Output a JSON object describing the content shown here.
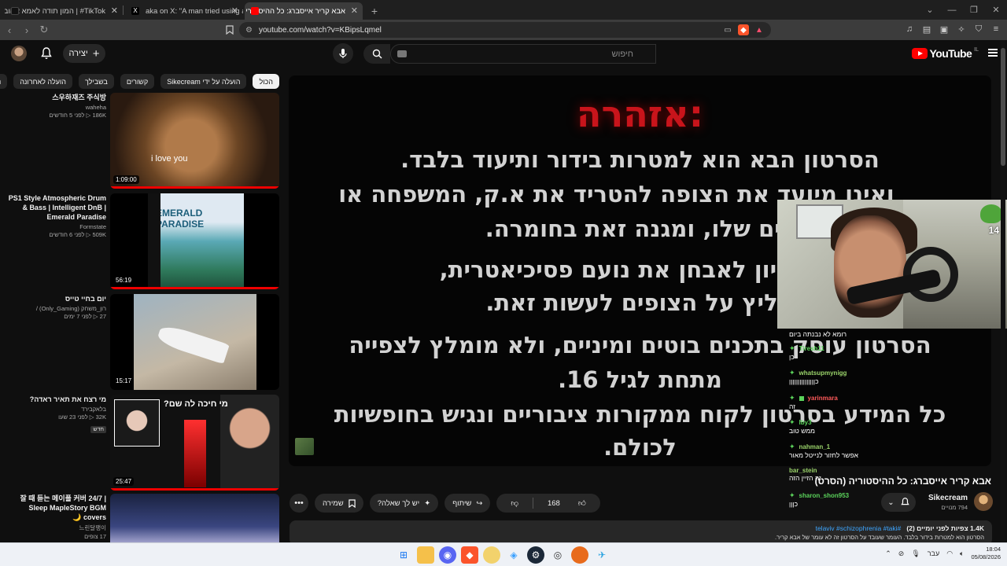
{
  "browser": {
    "tabs": [
      {
        "title": "TikTok# | המון תודה לאמא אהובה",
        "active": false,
        "fav_color": "#111111"
      },
      {
        "title": "aka on X: \"A man tried using an AI-g",
        "active": false,
        "fav_color": "#000000"
      },
      {
        "title": "אבא קריר אייסברג: כל ההיסטורי",
        "active": true,
        "fav_color": "#ff0000"
      }
    ],
    "new_tab": "+",
    "url": "youtube.com/watch?v=KBipsLqmel",
    "window_controls": [
      "⌄",
      "—",
      "❐",
      "✕"
    ]
  },
  "youtube": {
    "logo_text": "YouTube",
    "logo_country": "IL",
    "search_placeholder": "חיפוש",
    "create_label": "יצירה",
    "chips": [
      "הכול",
      "הועלה על ידי Sikecream",
      "קשורים",
      "בשבילך",
      "הועלה לאחרונה",
      "נצפו"
    ],
    "related": [
      {
        "title": "스우하재즈 주식방",
        "channel": "waheha",
        "stats": "186K ▷ לפני 5 חודשים",
        "duration": "1:09:00",
        "progress": 1.0,
        "thumb": "monkey",
        "caption": "i love you"
      },
      {
        "title": "PS1 Style Atmospheric Drum & Bass | Intelligent DnB | Emerald Paradise",
        "channel": "Formstate",
        "stats": "509K ▷ לפני 6 חודשים",
        "duration": "56:19",
        "progress": 1.0,
        "thumb": "ps1",
        "caption": "EMERALD PARADISE"
      },
      {
        "title": "יום בחיי טייס",
        "channel": "רון_משחק (Only_Gaming) /",
        "stats": "27 ▷ לפני 7 ימים",
        "duration": "15:17",
        "progress": 0.0,
        "thumb": "plane",
        "caption": ""
      },
      {
        "title": "מי רצח את תאיר ראדה?",
        "channel": "בלאקבירד",
        "stats": "32K ▷ לפני 23 שעו",
        "duration": "25:47",
        "progress": 1.0,
        "thumb": "tair",
        "caption": "מי חיכה לה שם?",
        "badge": "חדש"
      },
      {
        "title": "잘 때 듣는 메이플 커버 24/7 | Sleep MapleStory BGM covers 🌙",
        "channel": "느린달팽이",
        "stats": "17 צופים",
        "duration": "",
        "progress": 0.0,
        "thumb": "maple",
        "caption": ""
      }
    ]
  },
  "player": {
    "warning_title": "אזהרה:",
    "lines": [
      "הסרטון הבא הוא למטרות בידור ותיעוד בלבד.",
      "ואינו מיועד את הצופה להטריד את א.ק, המשפחה או",
      "רים שלו, ומגנה זאת בחומרה.",
      "צע נסיון לאבחן את נועם פסיכיאטרית,",
      "מליץ על הצופים לעשות זאת.",
      "הסרטון עוסק בתכנים בוטים ומיניים, ולא מומלץ לצפייה",
      "מתחת לגיל 16.",
      "כל המידע בסרטון לקוח ממקורות ציבוריים ונגיש בחופשיות",
      "לכולם."
    ],
    "webcam_badge": "14"
  },
  "chat": [
    {
      "user": "",
      "msg": "רומא לא נבנתה ביום",
      "color": "#ffffff"
    },
    {
      "user": "Tiresh11",
      "msg": "כן",
      "color": "#5bd35b"
    },
    {
      "user": "whatsupmynigg",
      "msg": "כןןןןןןןןןןןןןןן",
      "color": "#9ad36a"
    },
    {
      "user": "yarinmara",
      "msg": "זה",
      "color": "#ff5a5a"
    },
    {
      "user": "lby3",
      "msg": "ממש טוב",
      "color": "#5bd35b"
    },
    {
      "user": "nahman_1",
      "msg": "אפשר לחזור לנייטל מאור",
      "color": "#9ad36a"
    },
    {
      "user": "bar_stein",
      "msg": "זה הזיין הזה",
      "color": "#9ad36a"
    },
    {
      "user": "sharon_shon953",
      "msg": "כןןן",
      "color": "#5bd35b"
    }
  ],
  "video": {
    "title": "אבא קריר אייסברג: כל ההיסטוריה (הסרט)",
    "channel": "Sikecream",
    "subscribers": "794 מנויים",
    "likes": "168",
    "share": "שיתוף",
    "ask": "יש לך שאלה?",
    "save": "שמירה",
    "more": "•••",
    "desc_top": "1.4K צפיות  לפני יומיים (2)",
    "desc_tags": "#telaviv #schizophrenia #taki",
    "desc_body": "הסרטון הוא למטרות בידור בלבד. העומר שעובד על הסרטון זה לא עומר של אבא קריר."
  },
  "system": {
    "lang": "עבר",
    "time": "18:04",
    "date": "05/08/2026"
  }
}
